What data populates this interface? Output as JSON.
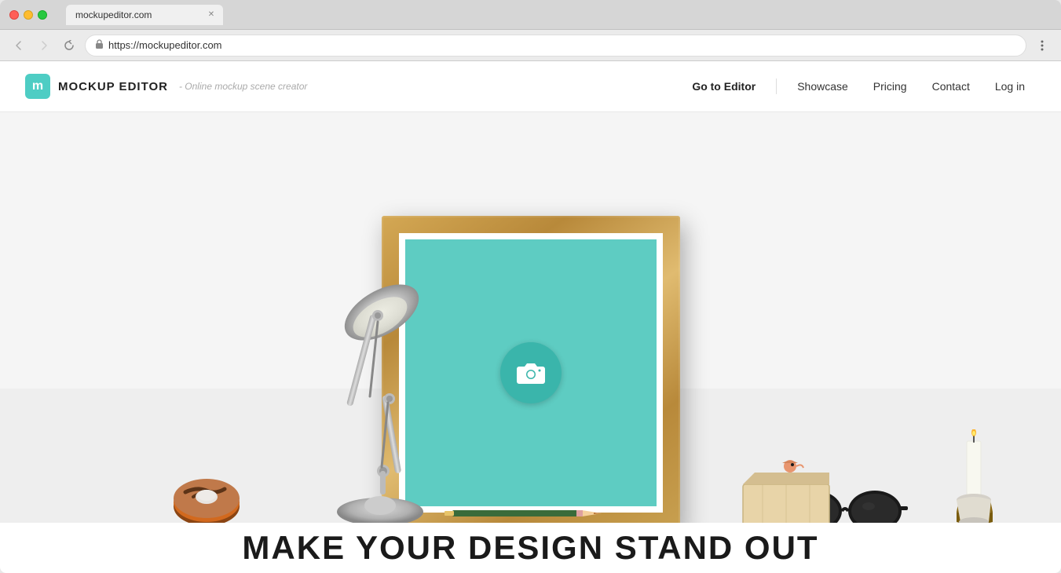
{
  "browser": {
    "url": "https://mockupeditor.com",
    "tab_label": "mockupeditor.com",
    "back_btn": "←",
    "forward_btn": "→",
    "refresh_btn": "↻",
    "menu_btn": "⋮"
  },
  "site": {
    "logo_letter": "m",
    "logo_name": "MOCKUP EDITOR",
    "logo_tagline": "- Online mockup scene creator",
    "nav": {
      "goto_editor": "Go to Editor",
      "showcase": "Showcase",
      "pricing": "Pricing",
      "contact": "Contact",
      "login": "Log in"
    }
  },
  "hero": {
    "headline": "MAKE YOUR DESIGN STAND OUT",
    "camera_label": "Upload image"
  },
  "colors": {
    "accent": "#4ecdc4",
    "frame_wood": "#c8a050",
    "canvas_bg": "#5eccc2",
    "camera_circle": "#3ab5ab"
  }
}
